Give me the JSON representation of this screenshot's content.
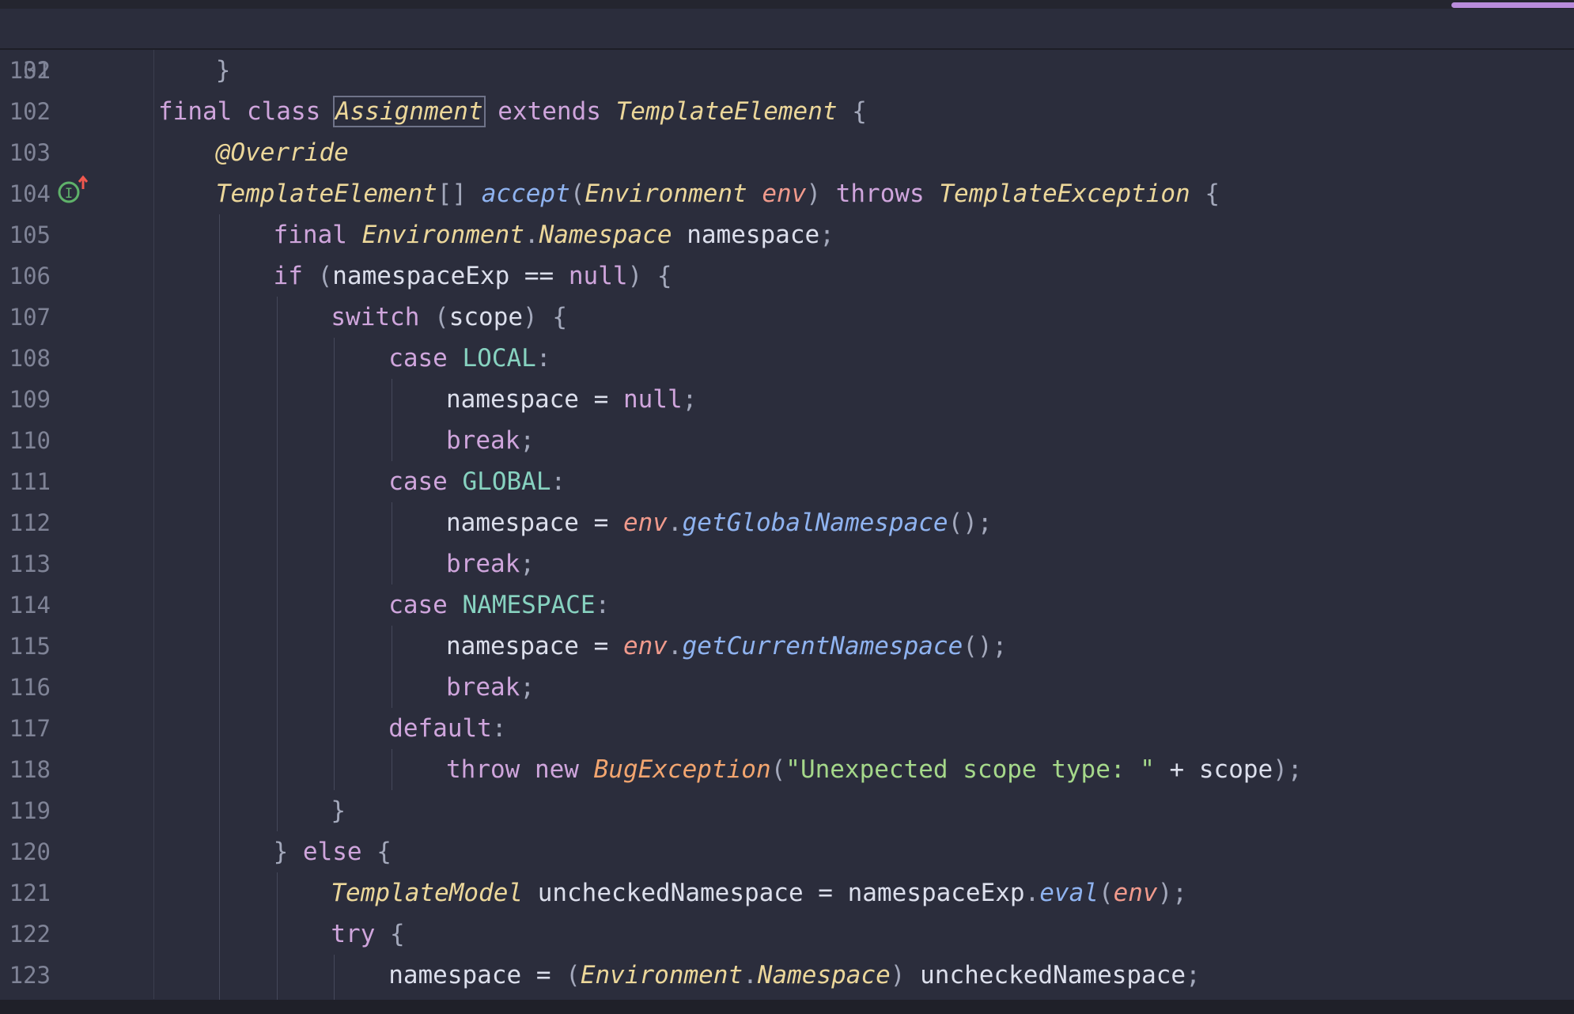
{
  "editor": {
    "sticky": {
      "num": "32",
      "tokens": [
        {
          "cls": "k",
          "text": "final class "
        },
        {
          "cls": "t hl",
          "text": "Assignment"
        },
        {
          "cls": "k",
          "text": " extends "
        },
        {
          "cls": "t",
          "text": "TemplateElement"
        },
        {
          "cls": "pn",
          "text": " {"
        }
      ]
    },
    "lines": [
      {
        "num": "101",
        "indent": 4,
        "tokens": [
          {
            "cls": "pn",
            "text": "}"
          }
        ]
      },
      {
        "num": "102",
        "indent": 0,
        "tokens": []
      },
      {
        "num": "103",
        "indent": 4,
        "tokens": [
          {
            "cls": "an",
            "text": "@Override"
          }
        ]
      },
      {
        "num": "104",
        "indent": 4,
        "tokens": [
          {
            "cls": "t",
            "text": "TemplateElement"
          },
          {
            "cls": "pn",
            "text": "[] "
          },
          {
            "cls": "m",
            "text": "accept"
          },
          {
            "cls": "pn",
            "text": "("
          },
          {
            "cls": "t",
            "text": "Environment "
          },
          {
            "cls": "p",
            "text": "env"
          },
          {
            "cls": "pn",
            "text": ") "
          },
          {
            "cls": "k",
            "text": "throws "
          },
          {
            "cls": "t",
            "text": "TemplateException"
          },
          {
            "cls": "pn",
            "text": " {"
          }
        ]
      },
      {
        "num": "105",
        "indent": 8,
        "tokens": [
          {
            "cls": "k",
            "text": "final "
          },
          {
            "cls": "t",
            "text": "Environment"
          },
          {
            "cls": "pn",
            "text": "."
          },
          {
            "cls": "t",
            "text": "Namespace "
          },
          {
            "cls": "n",
            "text": "namespace"
          },
          {
            "cls": "pn",
            "text": ";"
          }
        ]
      },
      {
        "num": "106",
        "indent": 8,
        "tokens": [
          {
            "cls": "k",
            "text": "if "
          },
          {
            "cls": "pn",
            "text": "("
          },
          {
            "cls": "n",
            "text": "namespaceExp == "
          },
          {
            "cls": "k",
            "text": "null"
          },
          {
            "cls": "pn",
            "text": ") {"
          }
        ]
      },
      {
        "num": "107",
        "indent": 12,
        "tokens": [
          {
            "cls": "k",
            "text": "switch "
          },
          {
            "cls": "pn",
            "text": "("
          },
          {
            "cls": "n",
            "text": "scope"
          },
          {
            "cls": "pn",
            "text": ") {"
          }
        ]
      },
      {
        "num": "108",
        "indent": 16,
        "tokens": [
          {
            "cls": "k",
            "text": "case "
          },
          {
            "cls": "c",
            "text": "LOCAL"
          },
          {
            "cls": "pn",
            "text": ":"
          }
        ]
      },
      {
        "num": "109",
        "indent": 20,
        "tokens": [
          {
            "cls": "n",
            "text": "namespace = "
          },
          {
            "cls": "k",
            "text": "null"
          },
          {
            "cls": "pn",
            "text": ";"
          }
        ]
      },
      {
        "num": "110",
        "indent": 20,
        "tokens": [
          {
            "cls": "k",
            "text": "break"
          },
          {
            "cls": "pn",
            "text": ";"
          }
        ]
      },
      {
        "num": "111",
        "indent": 16,
        "tokens": [
          {
            "cls": "k",
            "text": "case "
          },
          {
            "cls": "c",
            "text": "GLOBAL"
          },
          {
            "cls": "pn",
            "text": ":"
          }
        ]
      },
      {
        "num": "112",
        "indent": 20,
        "tokens": [
          {
            "cls": "n",
            "text": "namespace = "
          },
          {
            "cls": "p",
            "text": "env"
          },
          {
            "cls": "pn",
            "text": "."
          },
          {
            "cls": "m",
            "text": "getGlobalNamespace"
          },
          {
            "cls": "pn",
            "text": "();"
          }
        ]
      },
      {
        "num": "113",
        "indent": 20,
        "tokens": [
          {
            "cls": "k",
            "text": "break"
          },
          {
            "cls": "pn",
            "text": ";"
          }
        ]
      },
      {
        "num": "114",
        "indent": 16,
        "tokens": [
          {
            "cls": "k",
            "text": "case "
          },
          {
            "cls": "c",
            "text": "NAMESPACE"
          },
          {
            "cls": "pn",
            "text": ":"
          }
        ]
      },
      {
        "num": "115",
        "indent": 20,
        "tokens": [
          {
            "cls": "n",
            "text": "namespace = "
          },
          {
            "cls": "p",
            "text": "env"
          },
          {
            "cls": "pn",
            "text": "."
          },
          {
            "cls": "m",
            "text": "getCurrentNamespace"
          },
          {
            "cls": "pn",
            "text": "();"
          }
        ]
      },
      {
        "num": "116",
        "indent": 20,
        "tokens": [
          {
            "cls": "k",
            "text": "break"
          },
          {
            "cls": "pn",
            "text": ";"
          }
        ]
      },
      {
        "num": "117",
        "indent": 16,
        "tokens": [
          {
            "cls": "k",
            "text": "default"
          },
          {
            "cls": "pn",
            "text": ":"
          }
        ]
      },
      {
        "num": "118",
        "indent": 20,
        "tokens": [
          {
            "cls": "k",
            "text": "throw new "
          },
          {
            "cls": "ex",
            "text": "BugException"
          },
          {
            "cls": "pn",
            "text": "("
          },
          {
            "cls": "s",
            "text": "\"Unexpected scope type: \""
          },
          {
            "cls": "n",
            "text": " + scope"
          },
          {
            "cls": "pn",
            "text": ");"
          }
        ]
      },
      {
        "num": "119",
        "indent": 12,
        "tokens": [
          {
            "cls": "pn",
            "text": "}"
          }
        ]
      },
      {
        "num": "120",
        "indent": 8,
        "tokens": [
          {
            "cls": "pn",
            "text": "} "
          },
          {
            "cls": "k",
            "text": "else "
          },
          {
            "cls": "pn",
            "text": "{"
          }
        ]
      },
      {
        "num": "121",
        "indent": 12,
        "tokens": [
          {
            "cls": "t",
            "text": "TemplateModel "
          },
          {
            "cls": "n",
            "text": "uncheckedNamespace = namespaceExp"
          },
          {
            "cls": "pn",
            "text": "."
          },
          {
            "cls": "m",
            "text": "eval"
          },
          {
            "cls": "pn",
            "text": "("
          },
          {
            "cls": "p",
            "text": "env"
          },
          {
            "cls": "pn",
            "text": ");"
          }
        ]
      },
      {
        "num": "122",
        "indent": 12,
        "tokens": [
          {
            "cls": "k",
            "text": "try "
          },
          {
            "cls": "pn",
            "text": "{"
          }
        ]
      },
      {
        "num": "123",
        "indent": 16,
        "tokens": [
          {
            "cls": "n",
            "text": "namespace = "
          },
          {
            "cls": "pn",
            "text": "("
          },
          {
            "cls": "t",
            "text": "Environment"
          },
          {
            "cls": "pn",
            "text": "."
          },
          {
            "cls": "t",
            "text": "Namespace"
          },
          {
            "cls": "pn",
            "text": ") "
          },
          {
            "cls": "n",
            "text": "uncheckedNamespace"
          },
          {
            "cls": "pn",
            "text": ";"
          }
        ]
      }
    ]
  },
  "gutter": {
    "marker_icon": "implementing-method-icon",
    "marker_color": "#5fb26a",
    "arrow_color": "#f0584f"
  }
}
